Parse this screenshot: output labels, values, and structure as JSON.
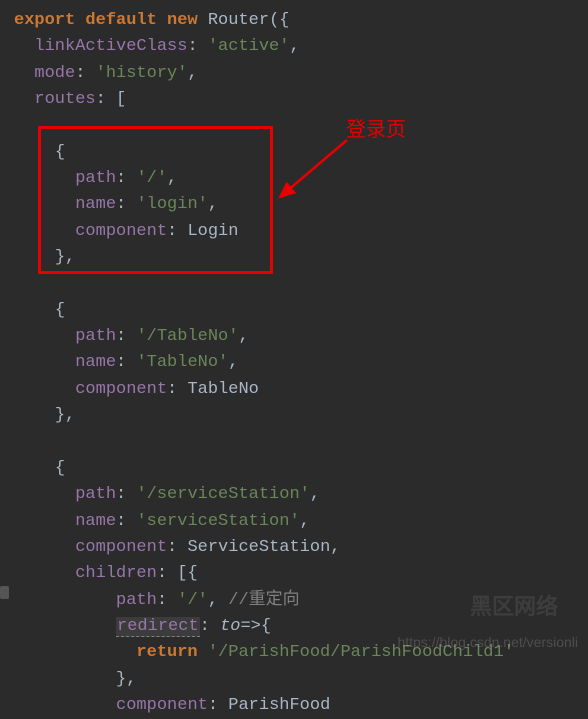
{
  "annotation": {
    "label": "登录页"
  },
  "code": {
    "l1": {
      "kw1": "export",
      "kw2": "default",
      "kw3": "new",
      "cls": "Router",
      "p": "({"
    },
    "l2": {
      "prop": "linkActiveClass",
      "str": "'active'",
      "p": ","
    },
    "l3": {
      "prop": "mode",
      "str": "'history'",
      "p": ","
    },
    "l4": {
      "prop": "routes",
      "p": ": ["
    },
    "b1": {
      "open": "{",
      "path_k": "path",
      "path_v": "'/'",
      "path_c": ",",
      "name_k": "name",
      "name_v": "'login'",
      "name_c": ",",
      "comp_k": "component",
      "comp_v": "Login",
      "close": "},"
    },
    "b2": {
      "open": "{",
      "path_k": "path",
      "path_v": "'/TableNo'",
      "path_c": ",",
      "name_k": "name",
      "name_v": "'TableNo'",
      "name_c": ",",
      "comp_k": "component",
      "comp_v": "TableNo",
      "close": "},"
    },
    "b3": {
      "open": "{",
      "path_k": "path",
      "path_v": "'/serviceStation'",
      "path_c": ",",
      "name_k": "name",
      "name_v": "'serviceStation'",
      "name_c": ",",
      "comp_k": "component",
      "comp_v": "ServiceStation",
      "comp_c": ",",
      "child_k": "children",
      "child_p": ": [{",
      "c_path_k": "path",
      "c_path_v": "'/'",
      "c_path_c": ",",
      "c_comment": "//重定向",
      "c_redir_k": "redirect",
      "c_redir_p1": ": ",
      "c_redir_param": "to",
      "c_redir_p2": "=>{",
      "c_ret_kw": "return",
      "c_ret_v": "'/ParishFood/ParishFoodChild1'",
      "c_close": "},",
      "c2_comp_k": "component",
      "c2_comp_v": "ParishFood"
    }
  },
  "watermark": {
    "text1": "https://blog.csdn.net/versionli",
    "text2": "黑区网络"
  }
}
